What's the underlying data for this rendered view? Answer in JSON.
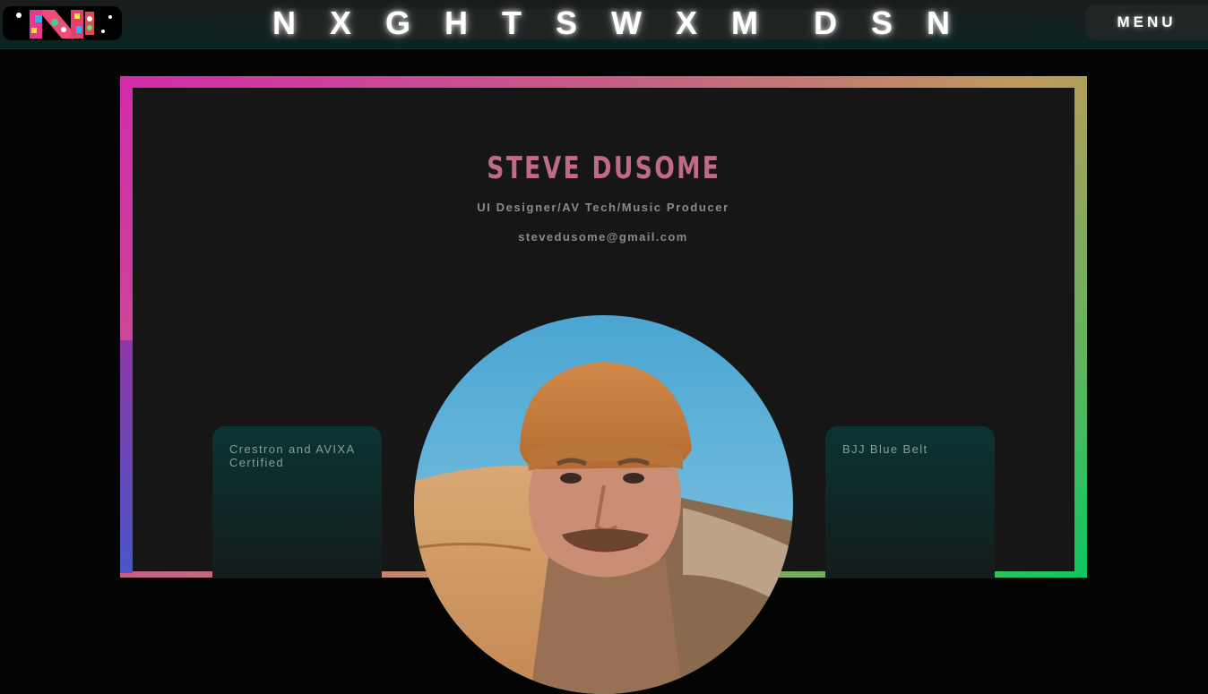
{
  "header": {
    "site_title": "N X G H T S W X M  D S N",
    "menu_label": "MENU",
    "logo_icon": "graffiti-n-logo-icon"
  },
  "profile": {
    "name": "STEVE DUSOME",
    "role": "UI Designer/AV Tech/Music Producer",
    "email": "stevedusome@gmail.com",
    "photo_icon": "profile-photo"
  },
  "cards": {
    "left": "Crestron and AVIXA Certified",
    "right": "BJJ Blue Belt"
  },
  "colors": {
    "accent_name": "#c06b86",
    "frame_gradient": [
      "#d12bab",
      "#c65f85",
      "#bf9a5c",
      "#0bc860"
    ],
    "card_bg": "#161616",
    "page_bg": "#030303",
    "side_card_top": "#0a3433"
  }
}
